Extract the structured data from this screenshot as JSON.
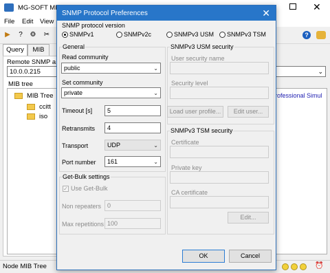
{
  "app": {
    "title": "MG-SOFT MIB",
    "menu": [
      "File",
      "Edit",
      "View"
    ],
    "tabs": [
      "Query",
      "MIB"
    ],
    "remote_snmp_label": "Remote SNMP a",
    "remote_address": "10.0.0.215",
    "mib_tree_label": "MIB tree",
    "tree": [
      {
        "label": "MIB Tree",
        "level": 0
      },
      {
        "label": "ccitt",
        "level": 1
      },
      {
        "label": "iso",
        "level": 1
      }
    ],
    "right_pane_text": "rofessional Simul",
    "status_text": "Node MIB Tree"
  },
  "dialog": {
    "title": "SNMP Protocol Preferences",
    "close_glyph": "✕",
    "version_group": "SNMP protocol version",
    "versions": [
      "SNMPv1",
      "SNMPv2c",
      "SNMPv3  USM",
      "SNMPv3  TSM"
    ],
    "selected_version": "SNMPv1",
    "general": {
      "title": "General",
      "read_community_label": "Read community",
      "read_community": "public",
      "set_community_label": "Set community",
      "set_community": "private",
      "timeout_label": "Timeout [s]",
      "timeout": "5",
      "retransmits_label": "Retransmits",
      "retransmits": "4",
      "transport_label": "Transport",
      "transport": "UDP",
      "port_label": "Port number",
      "port": "161"
    },
    "getbulk": {
      "title": "Get-Bulk settings",
      "use_label": "Use Get-Bulk",
      "use_checked": true,
      "non_repeaters_label": "Non repeaters",
      "non_repeaters": "0",
      "max_repetitions_label": "Max repetitions",
      "max_repetitions": "100"
    },
    "usm": {
      "title": "SNMPv3 USM security",
      "user_placeholder": "User security name",
      "level_placeholder": "Security level",
      "load_button": "Load user profile...",
      "edit_button": "Edit user..."
    },
    "tsm": {
      "title": "SNMPv3 TSM security",
      "certificate_placeholder": "Certificate",
      "private_key_placeholder": "Private key",
      "ca_placeholder": "CA certificate",
      "edit_button": "Edit..."
    },
    "ok_button": "OK",
    "cancel_button": "Cancel"
  },
  "colors": {
    "dialog_title_bar": "#2876c9",
    "link_text": "#1a1ab0"
  }
}
